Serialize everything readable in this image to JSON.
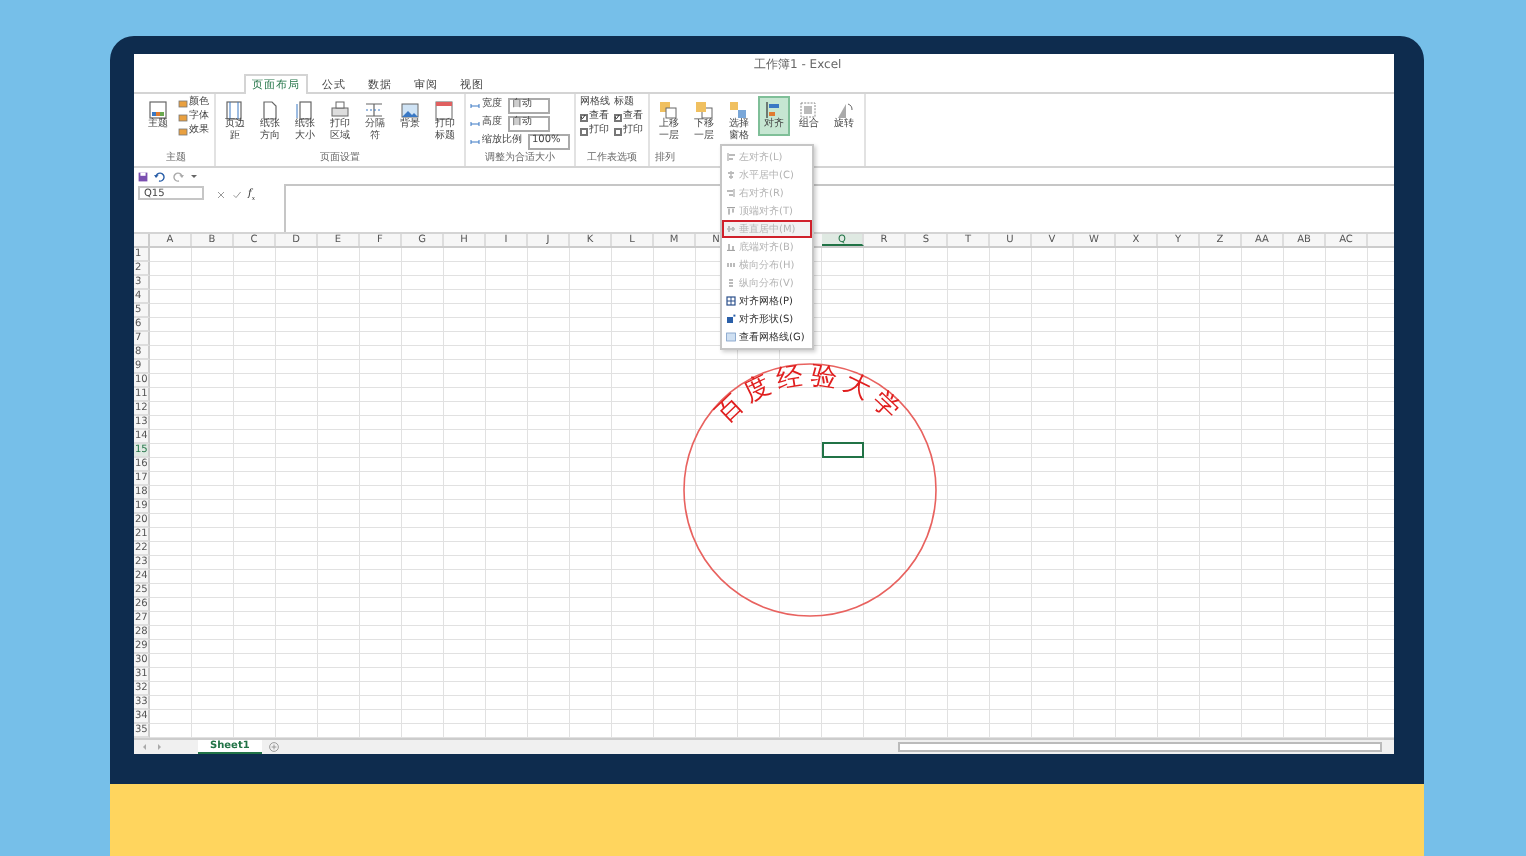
{
  "window": {
    "title": "工作簿1 - Excel"
  },
  "tabs": [
    {
      "label": "页面布局",
      "selected": true
    },
    {
      "label": "公式",
      "selected": false
    },
    {
      "label": "数据",
      "selected": false
    },
    {
      "label": "审阅",
      "selected": false
    },
    {
      "label": "视图",
      "selected": false
    }
  ],
  "ribbon": {
    "groups": [
      {
        "label": "主题",
        "items": [
          {
            "kind": "large",
            "label": "主题",
            "pressed": false
          },
          {
            "kind": "small",
            "label": "颜色"
          },
          {
            "kind": "small",
            "label": "字体"
          },
          {
            "kind": "small",
            "label": "效果"
          }
        ]
      },
      {
        "label": "页面设置",
        "items": [
          {
            "kind": "large",
            "label": "页边距",
            "pressed": false
          },
          {
            "kind": "large",
            "label": "纸张方向",
            "pressed": false
          },
          {
            "kind": "large",
            "label": "纸张大小",
            "pressed": false
          },
          {
            "kind": "large",
            "label": "打印区域",
            "pressed": false
          },
          {
            "kind": "large",
            "label": "分隔符",
            "pressed": false
          },
          {
            "kind": "large",
            "label": "背景",
            "pressed": false
          },
          {
            "kind": "large",
            "label": "打印标题",
            "pressed": false
          }
        ]
      },
      {
        "label": "调整为合适大小",
        "items": [
          {
            "kind": "dropdown",
            "label": "宽度",
            "value": "自动"
          },
          {
            "kind": "dropdown",
            "label": "高度",
            "value": "自动"
          },
          {
            "kind": "spin",
            "label": "缩放比例",
            "value": "100%"
          }
        ]
      },
      {
        "label": "工作表选项",
        "items": [
          {
            "kind": "options",
            "heading": "网格线",
            "checks": [
              {
                "label": "查看",
                "checked": true
              },
              {
                "label": "打印",
                "checked": false
              }
            ]
          },
          {
            "kind": "options",
            "heading": "标题",
            "checks": [
              {
                "label": "查看",
                "checked": true
              },
              {
                "label": "打印",
                "checked": false
              }
            ]
          }
        ]
      },
      {
        "label": "排列",
        "items": [
          {
            "kind": "large",
            "label": "上移一层",
            "pressed": false
          },
          {
            "kind": "large",
            "label": "下移一层",
            "pressed": false
          },
          {
            "kind": "large",
            "label": "选择窗格",
            "pressed": false
          },
          {
            "kind": "large",
            "label": "对齐",
            "pressed": true
          },
          {
            "kind": "large",
            "label": "组合",
            "pressed": false
          },
          {
            "kind": "large",
            "label": "旋转",
            "pressed": false
          }
        ]
      }
    ]
  },
  "name_box": {
    "value": "Q15"
  },
  "formula_bar": {
    "function_label": "f$_{x}$"
  },
  "columns": [
    {
      "label": "A",
      "selected": false
    },
    {
      "label": "B",
      "selected": false
    },
    {
      "label": "C",
      "selected": false
    },
    {
      "label": "D",
      "selected": false
    },
    {
      "label": "E",
      "selected": false
    },
    {
      "label": "F",
      "selected": false
    },
    {
      "label": "G",
      "selected": false
    },
    {
      "label": "H",
      "selected": false
    },
    {
      "label": "I",
      "selected": false
    },
    {
      "label": "J",
      "selected": false
    },
    {
      "label": "K",
      "selected": false
    },
    {
      "label": "L",
      "selected": false
    },
    {
      "label": "M",
      "selected": false
    },
    {
      "label": "N",
      "selected": false
    },
    {
      "kind": "covered"
    },
    {
      "kind": "covered"
    },
    {
      "label": "Q",
      "selected": true
    },
    {
      "label": "R",
      "selected": false
    },
    {
      "label": "S",
      "selected": false
    },
    {
      "label": "T",
      "selected": false
    },
    {
      "label": "U",
      "selected": false
    },
    {
      "label": "V",
      "selected": false
    },
    {
      "label": "W",
      "selected": false
    },
    {
      "label": "X",
      "selected": false
    },
    {
      "label": "Y",
      "selected": false
    },
    {
      "label": "Z",
      "selected": false
    },
    {
      "label": "AA",
      "selected": false
    },
    {
      "label": "AB",
      "selected": false
    },
    {
      "label": "AC",
      "selected": false
    }
  ],
  "rows": [
    {
      "label": "1",
      "selected": false
    },
    {
      "label": "2",
      "selected": false
    },
    {
      "label": "3",
      "selected": false
    },
    {
      "label": "4",
      "selected": false
    },
    {
      "label": "5",
      "selected": false
    },
    {
      "label": "6",
      "selected": false
    },
    {
      "label": "7",
      "selected": false
    },
    {
      "label": "8",
      "selected": false
    },
    {
      "label": "9",
      "selected": false
    },
    {
      "label": "10",
      "selected": false
    },
    {
      "label": "11",
      "selected": false
    },
    {
      "label": "12",
      "selected": false
    },
    {
      "label": "13",
      "selected": false
    },
    {
      "label": "14",
      "selected": false
    },
    {
      "label": "15",
      "selected": true
    },
    {
      "label": "16",
      "selected": false
    },
    {
      "label": "17",
      "selected": false
    },
    {
      "label": "18",
      "selected": false
    },
    {
      "label": "19",
      "selected": false
    },
    {
      "label": "20",
      "selected": false
    },
    {
      "label": "21",
      "selected": false
    },
    {
      "label": "22",
      "selected": false
    },
    {
      "label": "23",
      "selected": false
    },
    {
      "label": "24",
      "selected": false
    },
    {
      "label": "25",
      "selected": false
    },
    {
      "label": "26",
      "selected": false
    },
    {
      "label": "27",
      "selected": false
    },
    {
      "label": "28",
      "selected": false
    },
    {
      "label": "29",
      "selected": false
    },
    {
      "label": "30",
      "selected": false
    },
    {
      "label": "31",
      "selected": false
    },
    {
      "label": "32",
      "selected": false
    },
    {
      "label": "33",
      "selected": false
    },
    {
      "label": "34",
      "selected": false
    },
    {
      "label": "35",
      "selected": false
    }
  ],
  "sheets": [
    {
      "label": "Sheet1",
      "selected": true
    }
  ],
  "align_menu": {
    "items": [
      {
        "label": "左对齐(L)",
        "disabled": true,
        "selected": false
      },
      {
        "label": "水平居中(C)",
        "disabled": true,
        "selected": false
      },
      {
        "label": "右对齐(R)",
        "disabled": true,
        "selected": false
      },
      {
        "label": "顶端对齐(T)",
        "disabled": true,
        "selected": false
      },
      {
        "label": "垂直居中(M)",
        "disabled": true,
        "selected": true
      },
      {
        "label": "底端对齐(B)",
        "disabled": true,
        "selected": false
      },
      {
        "label": "横向分布(H)",
        "disabled": true,
        "selected": false
      },
      {
        "label": "纵向分布(V)",
        "disabled": true,
        "selected": false
      },
      {
        "label": "对齐网格(P)",
        "disabled": false,
        "selected": false
      },
      {
        "label": "对齐形状(S)",
        "disabled": false,
        "selected": false
      },
      {
        "label": "查看网格线(G)",
        "disabled": false,
        "selected": false
      }
    ]
  },
  "stamp": {
    "text": "百度经验大学"
  }
}
